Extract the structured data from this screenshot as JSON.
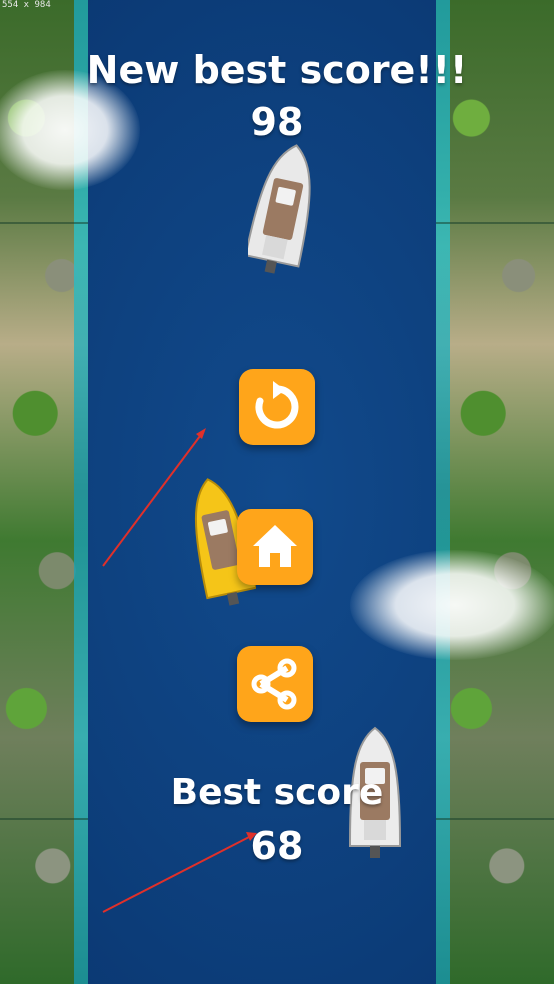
{
  "screenshot_label": "554 x 984",
  "game_over": {
    "headline": "New best score!!!",
    "score": "98"
  },
  "best": {
    "label": "Best score",
    "value": "68"
  },
  "buttons": {
    "restart_icon": "restart-arrow-icon",
    "home_icon": "home-icon",
    "share_icon": "share-icon"
  },
  "colors": {
    "river": "#0d3f7c",
    "button": "#ffa51a",
    "player_boat": "#f5c518",
    "enemy_boat": "#e9e9e9",
    "annotation_arrow": "#e0302a"
  }
}
